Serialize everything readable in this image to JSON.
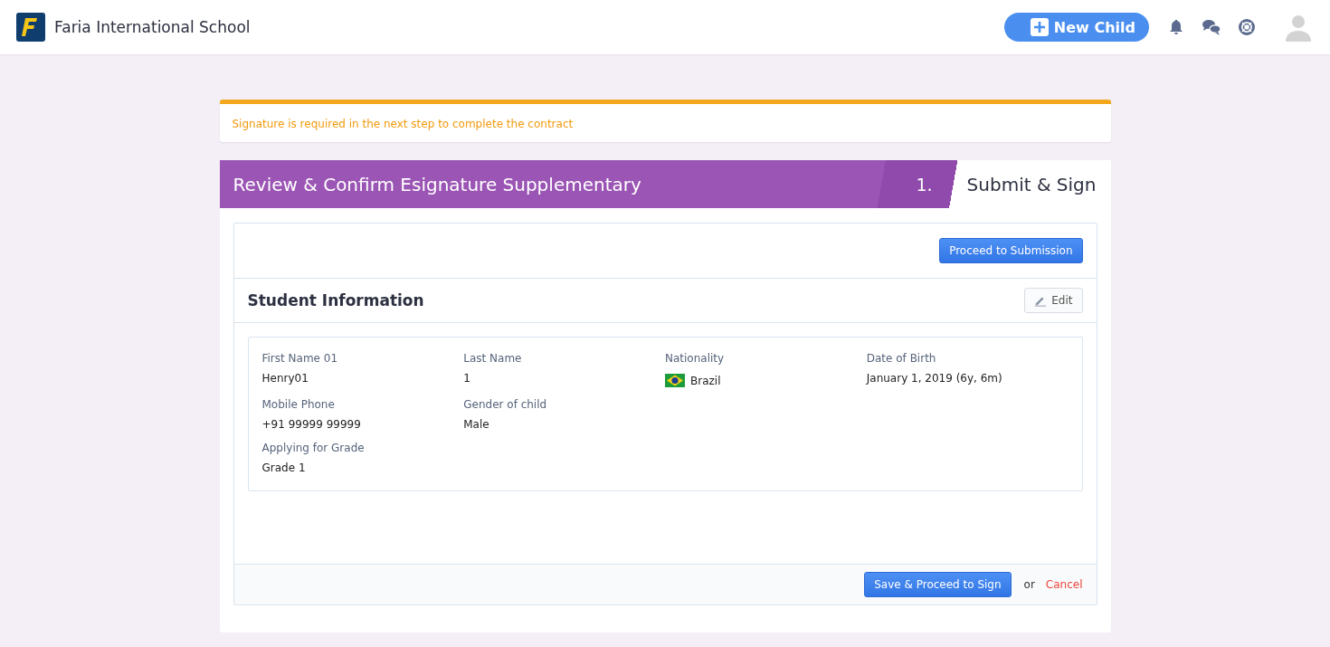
{
  "header": {
    "school_name": "Faria International School",
    "new_child_button": "New Child"
  },
  "alert": {
    "text": "Signature is required in the next step to complete the contract"
  },
  "form_title": "Review & Confirm Esignature Supplementary",
  "step": {
    "number": "1.",
    "label": "Submit & Sign"
  },
  "proceed_button": "Proceed to Submission",
  "section": {
    "title": "Student Information",
    "edit_button": "Edit"
  },
  "field_rows": [
    [
      {
        "label": "First Name 01",
        "value": "Henry01",
        "kind": "text"
      },
      {
        "label": "Last Name",
        "value": "1",
        "kind": "text"
      },
      {
        "label": "Nationality",
        "value": "Brazil",
        "kind": "flag"
      },
      {
        "label": "Date of Birth",
        "value": "January 1, 2019 (6y, 6m)",
        "kind": "text"
      }
    ],
    [
      {
        "label": "Mobile Phone",
        "value": "+91 99999 99999",
        "kind": "text"
      },
      {
        "label": "Gender of child",
        "value": "Male",
        "kind": "text"
      }
    ],
    [
      {
        "label": "Applying for Grade",
        "value": "Grade 1",
        "kind": "text"
      }
    ]
  ],
  "footer": {
    "save_button": "Save & Proceed to Sign",
    "or_text": "or",
    "cancel_link": "Cancel"
  }
}
